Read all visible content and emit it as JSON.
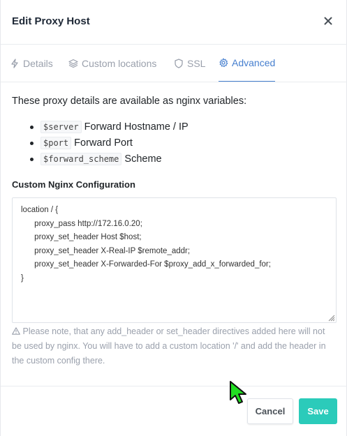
{
  "dialog": {
    "title": "Edit Proxy Host",
    "close_glyph": "×"
  },
  "tabs": [
    {
      "label": "Details",
      "icon": "bolt-icon",
      "active": false
    },
    {
      "label": "Custom locations",
      "icon": "layers-icon",
      "active": false
    },
    {
      "label": "SSL",
      "icon": "shield-icon",
      "active": false
    },
    {
      "label": "Advanced",
      "icon": "gear-icon",
      "active": true
    }
  ],
  "advanced": {
    "intro": "These proxy details are available as nginx variables:",
    "variables": [
      {
        "code": "$server",
        "desc": "Forward Hostname / IP"
      },
      {
        "code": "$port",
        "desc": "Forward Port"
      },
      {
        "code": "$forward_scheme",
        "desc": "Scheme"
      }
    ],
    "config_label": "Custom Nginx Configuration",
    "config_value": "location / {\n      proxy_pass http://172.16.0.20;\n      proxy_set_header Host $host;\n      proxy_set_header X-Real-IP $remote_addr;\n      proxy_set_header X-Forwarded-For $proxy_add_x_forwarded_for;\n}",
    "note": "Please note, that any add_header or set_header directives added here will not be used by nginx. You will have to add a custom location '/' and add the header in the custom config there."
  },
  "footer": {
    "cancel_label": "Cancel",
    "save_label": "Save"
  },
  "colors": {
    "accent": "#467fcf",
    "save": "#2bcbba",
    "muted": "#9aa0ac",
    "cursor": "#22dd22"
  }
}
